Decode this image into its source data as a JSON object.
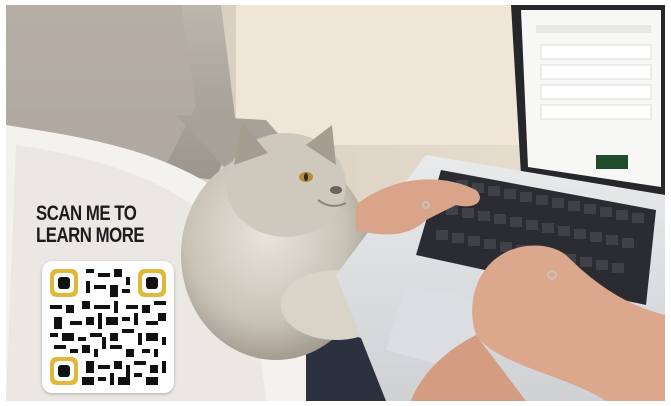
{
  "promo": {
    "cta_line1": "SCAN ME TO",
    "cta_line2": "LEARN MORE"
  },
  "qr": {
    "finder_color": "#e0b83a",
    "module_color": "#111111"
  },
  "laptop_screen": {
    "primary_button_color": "#1f4d2c"
  },
  "icons": [
    "qr-code-icon",
    "laptop-icon",
    "cat-icon"
  ]
}
